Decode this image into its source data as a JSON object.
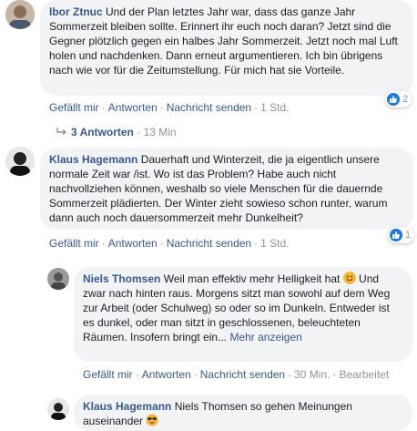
{
  "comments": [
    {
      "author": "Ibor Ztnuc",
      "text": "Und der Plan letztes Jahr war, dass das ganze Jahr Sommerzeit bleiben sollte. Erinnert ihr euch noch daran? Jetzt sind die Gegner plötzlich gegen ein halbes Jahr Sommerzeit. Jetzt noch mal Luft holen und nachdenken. Dann erneut argumentieren. Ich bin übrigens nach wie vor für die Zeitumstellung. Für mich hat sie Vorteile.",
      "actions": {
        "like": "Gefällt mir",
        "reply": "Antworten",
        "message": "Nachricht senden",
        "time": "1 Std."
      },
      "reaction_count": "2"
    },
    {
      "author": "Klaus Hagemann",
      "text": "Dauerhaft und Winterzeit, die ja eigentlich unsere normale Zeit war /ist. Wo ist das Problem? Habe auch nicht nachvollziehen können, weshalb so viele Menschen für die dauernde Sommerzeit plädierten. Der Winter zieht sowieso schon runter, warum dann auch noch dauersommerzeit mehr Dunkelheit?",
      "actions": {
        "like": "Gefällt mir",
        "reply": "Antworten",
        "message": "Nachricht senden",
        "time": "1 Std."
      },
      "reaction_count": "1"
    }
  ],
  "replies_toggle": {
    "label": "3 Antworten",
    "time": "13 Min"
  },
  "replies": [
    {
      "author": "Niels Thomsen",
      "text": "Weil man effektiv mehr Helligkeit hat",
      "text_cont": "Und zwar nach hinten raus. Morgens sitzt man sowohl auf dem Weg zur Arbeit (oder Schulweg) so oder so im Dunkeln. Entweder ist es dunkel, oder man sitzt in geschlossenen, beleuchteten Räumen. Insofern bringt ein...",
      "more": "Mehr anzeigen",
      "actions": {
        "like": "Gefällt mir",
        "reply": "Antworten",
        "message": "Nachricht senden",
        "time": "30 Min.",
        "edited": "Bearbeitet"
      }
    },
    {
      "author": "Klaus Hagemann",
      "text": "Niels Thomsen so gehen Meinungen auseinander"
    }
  ],
  "icons": {
    "like": "like-icon",
    "reply_arrow": "reply-arrow-icon",
    "smile_emoji": "smile-emoji-icon",
    "sunglasses_emoji": "sunglasses-emoji-icon"
  },
  "colors": {
    "link": "#385898",
    "like_blue": "#1877f2",
    "bubble": "#f2f3f5",
    "muted": "#90949c"
  }
}
